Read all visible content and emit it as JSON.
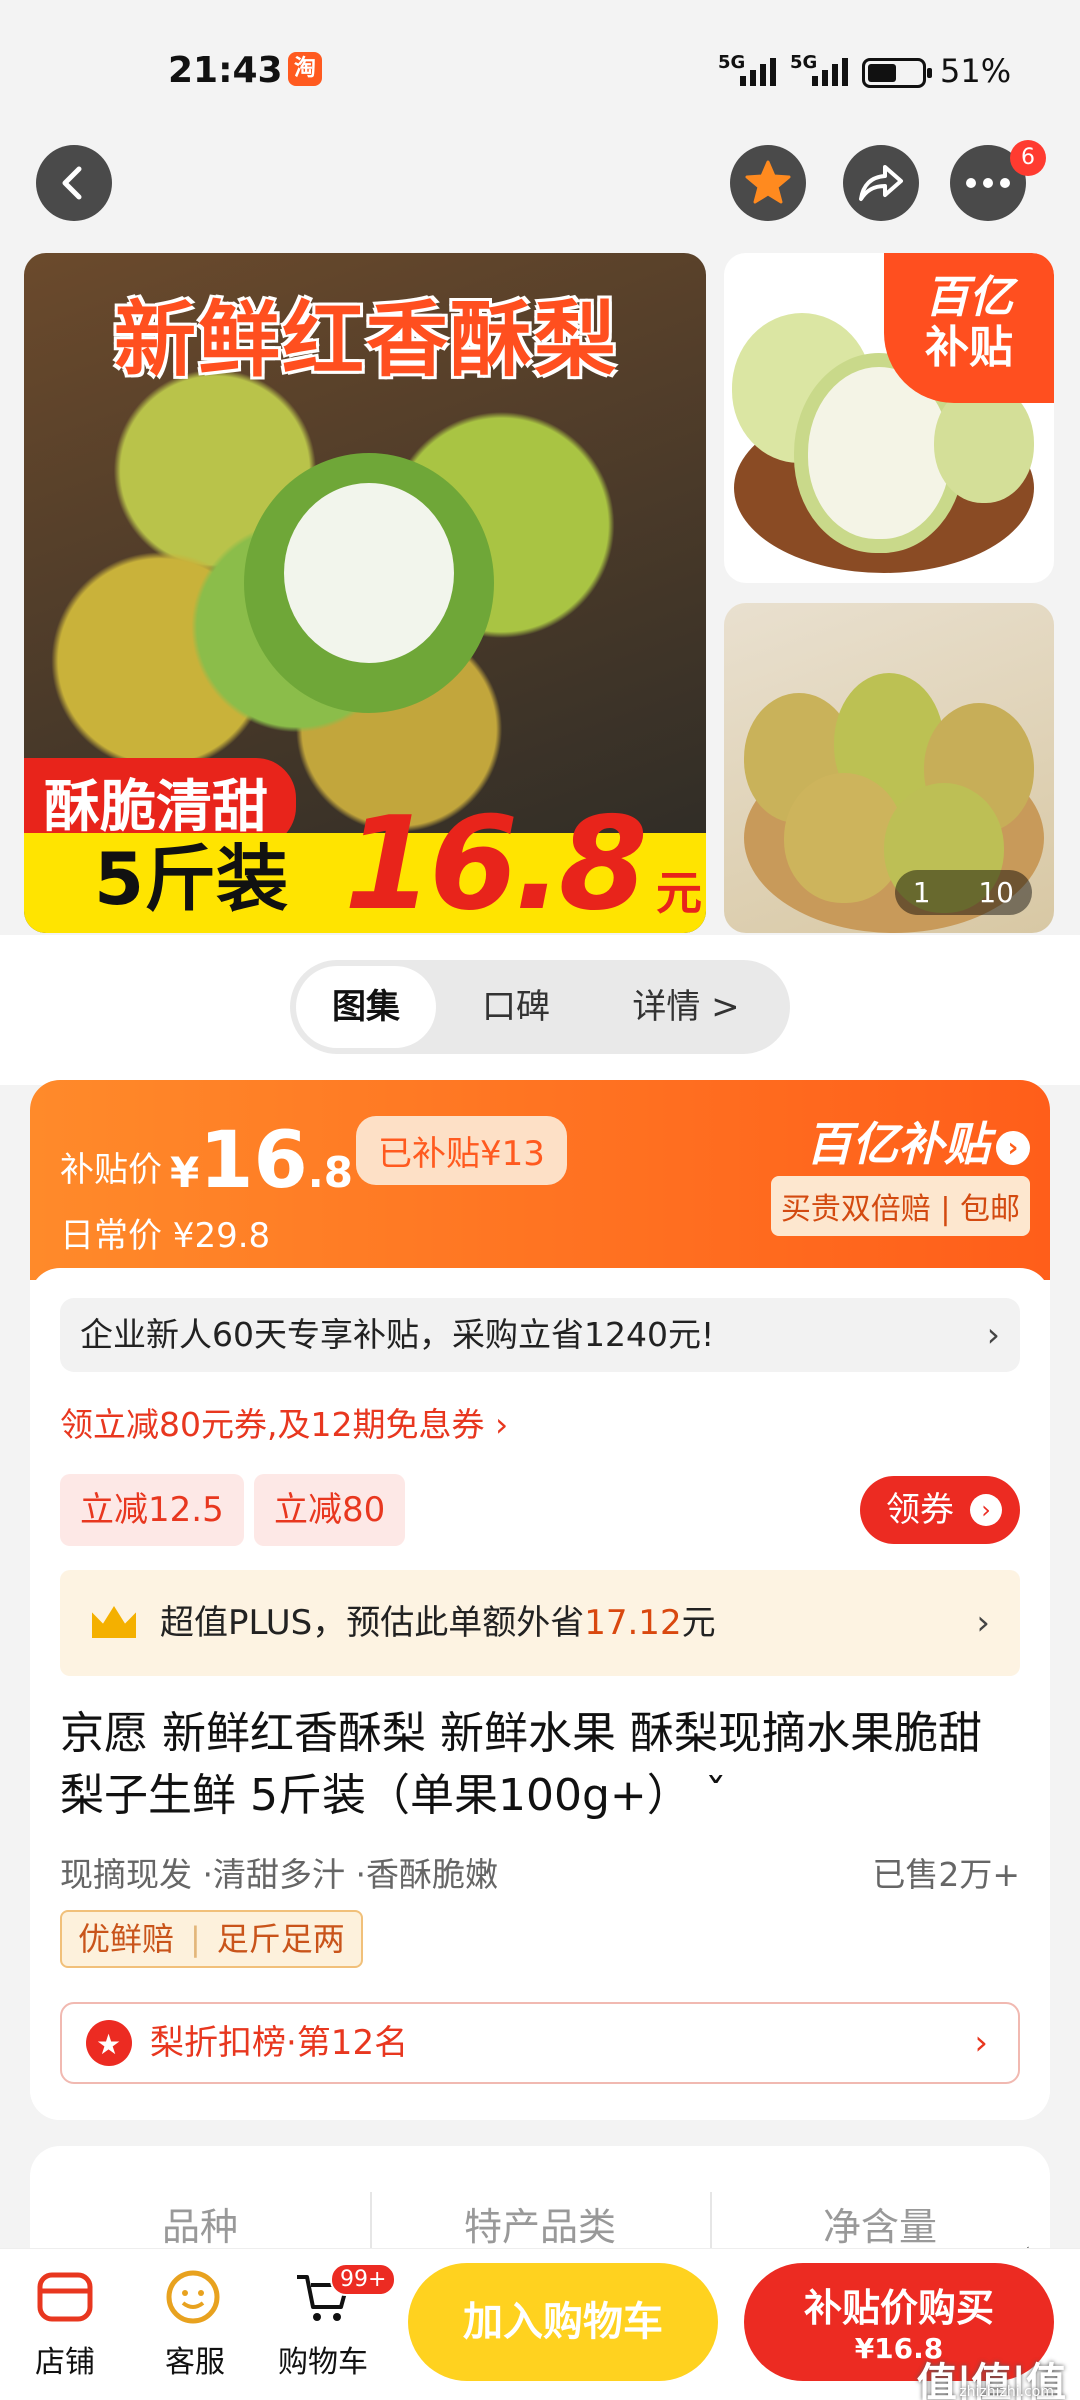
{
  "status_bar": {
    "time": "21:43",
    "app_icon_text": "淘",
    "signal_1": "5G",
    "signal_2": "5G",
    "battery": "51%"
  },
  "nav": {
    "back_icon": "chevron-left-icon",
    "favorite_icon": "star-icon",
    "share_icon": "share-icon",
    "more_icon": "more-icon",
    "more_badge": "6"
  },
  "gallery": {
    "hero_title": "新鲜红香酥梨",
    "hero_tag": "酥脆清甜",
    "hero_pack": "5斤装",
    "hero_price": "16.8",
    "hero_unit": "元",
    "corner_line1": "百亿",
    "corner_line2": "补贴",
    "page_current": "1",
    "page_total": "10"
  },
  "tabs": [
    "图集",
    "口碑",
    "详情 >"
  ],
  "price": {
    "subsidy_label": "补贴价",
    "currency": "¥",
    "price_int": "16",
    "price_dec": ".8",
    "saved": "已补贴¥13",
    "daily": "日常价 ¥29.8",
    "brand": "百亿补贴",
    "brand_sub": "买贵双倍赔 | 包邮"
  },
  "promo": {
    "notice": "企业新人60天专享补贴，采购立省1240元!",
    "coupon_line": "领立减80元券,及12期免息券 ›",
    "chips": [
      "立减12.5",
      "立减80"
    ],
    "get_coupon": "领券",
    "plus_prefix": "超值PLUS，预估此单额外省",
    "plus_amount": "17.12",
    "plus_suffix": "元"
  },
  "product": {
    "title": "京愿 新鲜红香酥梨 新鲜水果 酥梨现摘水果脆甜梨子生鲜 5斤装（单果100g+） ˇ",
    "features": "现摘现发 ·清甜多汁 ·香酥脆嫩",
    "sold": "已售2万+",
    "guarantees": [
      "优鲜赔",
      "足斤足两"
    ],
    "rank": "梨折扣榜·第12名"
  },
  "specs": [
    "品种",
    "特产品类",
    "净含量"
  ],
  "bottom_bar": {
    "shop": "店铺",
    "service": "客服",
    "cart": "购物车",
    "cart_badge": "99+",
    "add_cart": "加入购物车",
    "buy_line1": "补贴价购买",
    "buy_line2": "¥16.8"
  },
  "watermark": {
    "main": "值|值|值",
    "sub": "zhizhizhi.com"
  },
  "colors": {
    "accent": "#ff5e1a",
    "red": "#ec2b22",
    "yellow": "#ffd21f"
  }
}
